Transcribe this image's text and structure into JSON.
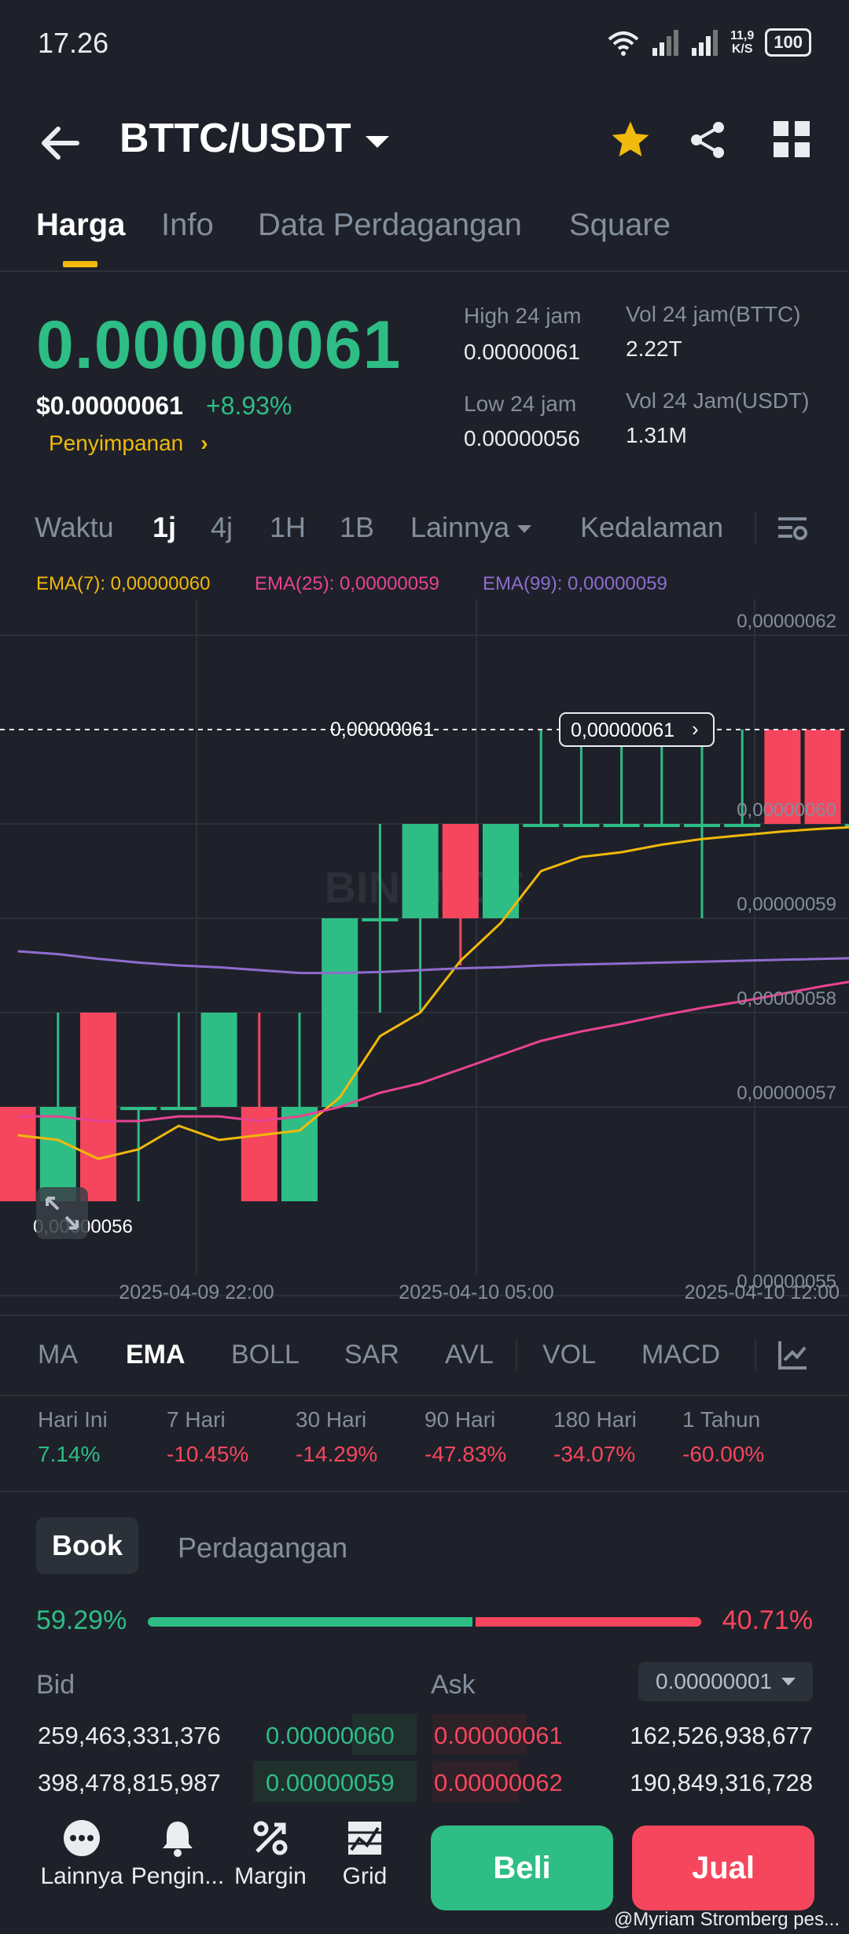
{
  "status": {
    "time": "17.26",
    "speed_top": "11,9",
    "speed_unit": "K/S",
    "battery": "100"
  },
  "header": {
    "pair": "BTTC/USDT"
  },
  "tabs": [
    {
      "label": "Harga"
    },
    {
      "label": "Info"
    },
    {
      "label": "Data Perdagangan"
    },
    {
      "label": "Square"
    }
  ],
  "price": {
    "last": "0.00000061",
    "fiat": "$0.00000061",
    "change": "+8.93%",
    "deposit": "Penyimpanan"
  },
  "stats": {
    "high_label": "High 24 jam",
    "high_value": "0.00000061",
    "low_label": "Low 24 jam",
    "low_value": "0.00000056",
    "vol_btt_label": "Vol 24 jam(BTTC)",
    "vol_btt_value": "2.22T",
    "vol_usdt_label": "Vol 24 Jam(USDT)",
    "vol_usdt_value": "1.31M"
  },
  "intervals": {
    "time": "Waktu",
    "i1": "1j",
    "i2": "4j",
    "i3": "1H",
    "i4": "1B",
    "more": "Lainnya",
    "depth": "Kedalaman"
  },
  "ema_legend": {
    "ema7": "EMA(7): 0,00000060",
    "ema25": "EMA(25): 0,00000059",
    "ema99": "EMA(99): 0,00000059"
  },
  "chart_labels": {
    "current_left": "0,00000061",
    "current_box": "0,00000061",
    "low_marker": "0,00000056",
    "watermark": "BINANCE"
  },
  "chart_data": {
    "type": "candlestick",
    "y_ticks": [
      "0,00000062",
      "0,00000060",
      "0,00000059",
      "0,00000058",
      "0,00000057",
      "0,00000055"
    ],
    "x_ticks": [
      "2025-04-09 22:00",
      "2025-04-10 05:00",
      "2025-04-10 12:00"
    ],
    "ylim": [
      5.53e-07,
      6.23e-07
    ],
    "candles": [
      {
        "o": 5.7e-07,
        "h": 5.7e-07,
        "l": 5.6e-07,
        "c": 5.6e-07
      },
      {
        "o": 5.6e-07,
        "h": 5.8e-07,
        "l": 5.6e-07,
        "c": 5.7e-07
      },
      {
        "o": 5.8e-07,
        "h": 5.8e-07,
        "l": 5.6e-07,
        "c": 5.6e-07
      },
      {
        "o": 5.7e-07,
        "h": 5.7e-07,
        "l": 5.6e-07,
        "c": 5.7e-07
      },
      {
        "o": 5.7e-07,
        "h": 5.8e-07,
        "l": 5.7e-07,
        "c": 5.7e-07
      },
      {
        "o": 5.7e-07,
        "h": 5.8e-07,
        "l": 5.7e-07,
        "c": 5.8e-07
      },
      {
        "o": 5.7e-07,
        "h": 5.8e-07,
        "l": 5.6e-07,
        "c": 5.6e-07
      },
      {
        "o": 5.6e-07,
        "h": 5.8e-07,
        "l": 5.6e-07,
        "c": 5.7e-07
      },
      {
        "o": 5.7e-07,
        "h": 5.9e-07,
        "l": 5.7e-07,
        "c": 5.9e-07
      },
      {
        "o": 5.9e-07,
        "h": 6e-07,
        "l": 5.8e-07,
        "c": 5.9e-07
      },
      {
        "o": 5.9e-07,
        "h": 6e-07,
        "l": 5.8e-07,
        "c": 6e-07
      },
      {
        "o": 6e-07,
        "h": 6e-07,
        "l": 5.85e-07,
        "c": 5.9e-07
      },
      {
        "o": 5.9e-07,
        "h": 6e-07,
        "l": 5.9e-07,
        "c": 6e-07
      },
      {
        "o": 6e-07,
        "h": 6.1e-07,
        "l": 6e-07,
        "c": 6e-07
      },
      {
        "o": 6e-07,
        "h": 6.1e-07,
        "l": 6e-07,
        "c": 6e-07
      },
      {
        "o": 6e-07,
        "h": 6.1e-07,
        "l": 6e-07,
        "c": 6e-07
      },
      {
        "o": 6e-07,
        "h": 6.1e-07,
        "l": 6e-07,
        "c": 6e-07
      },
      {
        "o": 6e-07,
        "h": 6.1e-07,
        "l": 5.9e-07,
        "c": 6e-07
      },
      {
        "o": 6e-07,
        "h": 6.1e-07,
        "l": 6e-07,
        "c": 6e-07
      },
      {
        "o": 6.1e-07,
        "h": 6.1e-07,
        "l": 6e-07,
        "c": 6e-07
      },
      {
        "o": 6.1e-07,
        "h": 6.1e-07,
        "l": 6e-07,
        "c": 6e-07
      },
      {
        "o": 6e-07,
        "h": 6.1e-07,
        "l": 6e-07,
        "c": 6e-07
      },
      {
        "o": 6e-07,
        "h": 6.1e-07,
        "l": 6e-07,
        "c": 6e-07
      }
    ],
    "series": [
      {
        "name": "EMA(7)",
        "color": "#f0b90b",
        "values": [
          5.67e-07,
          5.665e-07,
          5.645e-07,
          5.655e-07,
          5.68e-07,
          5.665e-07,
          5.67e-07,
          5.675e-07,
          5.71e-07,
          5.775e-07,
          5.8e-07,
          5.855e-07,
          5.895e-07,
          5.95e-07,
          5.965e-07,
          5.97e-07,
          5.978e-07,
          5.984e-07,
          5.988e-07,
          5.992e-07,
          5.995e-07,
          5.997e-07,
          5.999e-07
        ]
      },
      {
        "name": "EMA(25)",
        "color": "#e84393",
        "values": [
          5.69e-07,
          5.69e-07,
          5.685e-07,
          5.685e-07,
          5.69e-07,
          5.69e-07,
          5.685e-07,
          5.69e-07,
          5.7e-07,
          5.715e-07,
          5.725e-07,
          5.74e-07,
          5.755e-07,
          5.77e-07,
          5.78e-07,
          5.788e-07,
          5.797e-07,
          5.805e-07,
          5.812e-07,
          5.82e-07,
          5.828e-07,
          5.835e-07,
          5.84e-07
        ]
      },
      {
        "name": "EMA(99)",
        "color": "#8e6ccf",
        "values": [
          5.865e-07,
          5.862e-07,
          5.857e-07,
          5.853e-07,
          5.85e-07,
          5.848e-07,
          5.845e-07,
          5.842e-07,
          5.842e-07,
          5.843e-07,
          5.845e-07,
          5.847e-07,
          5.848e-07,
          5.85e-07,
          5.851e-07,
          5.852e-07,
          5.853e-07,
          5.854e-07,
          5.855e-07,
          5.856e-07,
          5.857e-07,
          5.858e-07,
          5.859e-07
        ]
      }
    ]
  },
  "indicators": [
    "MA",
    "EMA",
    "BOLL",
    "SAR",
    "AVL",
    "VOL",
    "MACD"
  ],
  "performance": [
    {
      "label": "Hari Ini",
      "value": "7.14%",
      "color": "#2ebd85"
    },
    {
      "label": "7 Hari",
      "value": "-10.45%",
      "color": "#f6465d"
    },
    {
      "label": "30 Hari",
      "value": "-14.29%",
      "color": "#f6465d"
    },
    {
      "label": "90 Hari",
      "value": "-47.83%",
      "color": "#f6465d"
    },
    {
      "label": "180 Hari",
      "value": "-34.07%",
      "color": "#f6465d"
    },
    {
      "label": "1 Tahun",
      "value": "-60.00%",
      "color": "#f6465d"
    }
  ],
  "orderbook": {
    "tab_book": "Book",
    "tab_trades": "Perdagangan",
    "bid_ratio": "59.29%",
    "ask_ratio": "40.71%",
    "bid_fraction": 0.5929,
    "bid_label": "Bid",
    "ask_label": "Ask",
    "precision": "0.00000001",
    "rows": [
      {
        "bid_qty": "259,463,331,376",
        "bid_price": "0.00000060",
        "ask_price": "0.00000061",
        "ask_qty": "162,526,938,677"
      },
      {
        "bid_qty": "398,478,815,987",
        "bid_price": "0.00000059",
        "ask_price": "0.00000062",
        "ask_qty": "190,849,316,728"
      }
    ]
  },
  "bottom": {
    "more": "Lainnya",
    "alert": "Pengin...",
    "margin": "Margin",
    "grid": "Grid",
    "buy": "Beli",
    "sell": "Jual",
    "watermark": "@Myriam Stromberg pes..."
  },
  "colors": {
    "up": "#2ebd85",
    "down": "#f6465d",
    "accent": "#f0b90b",
    "bg": "#1e2129"
  }
}
